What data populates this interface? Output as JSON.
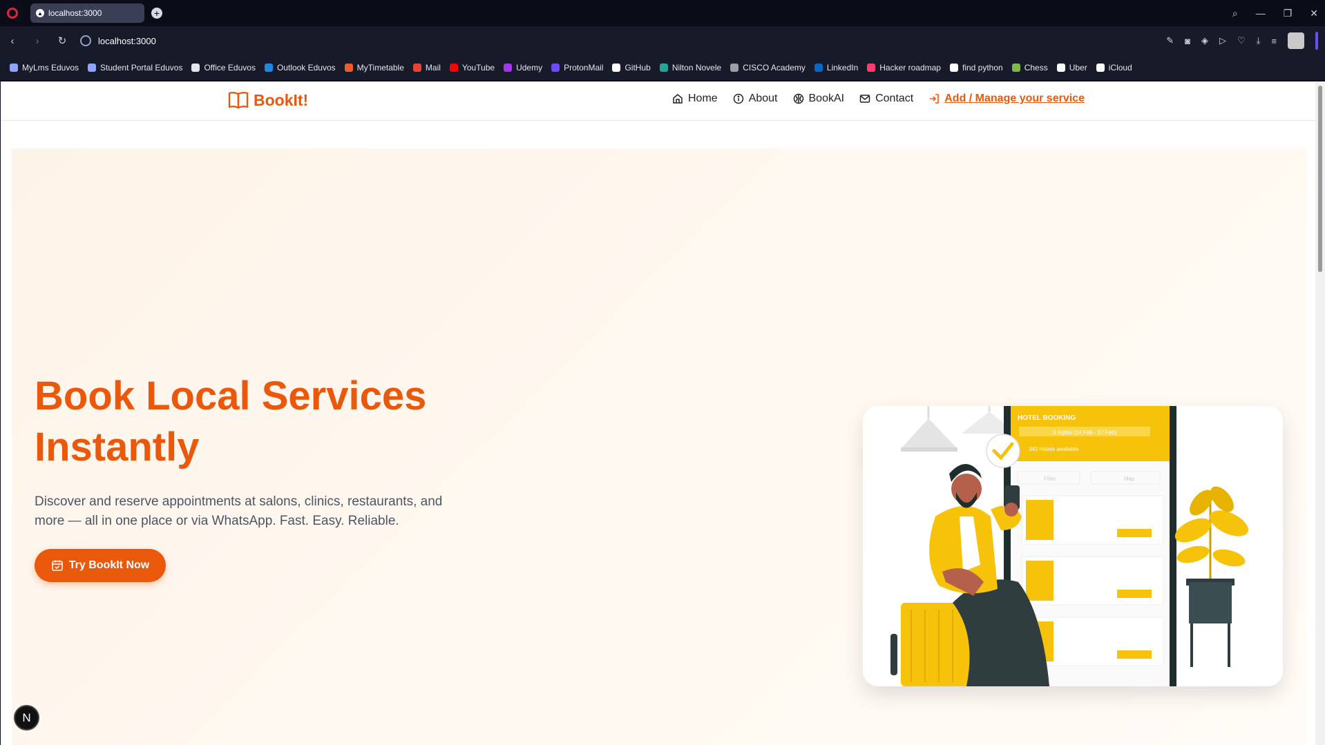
{
  "browser": {
    "tab_title": "localhost:3000",
    "url": "localhost:3000",
    "bookmarks": [
      {
        "label": "MyLms Eduvos",
        "color": "#8ea2ff"
      },
      {
        "label": "Student Portal Eduvos",
        "color": "#8ea2ff"
      },
      {
        "label": "Office Eduvos",
        "color": "#e6e7ee"
      },
      {
        "label": "Outlook Eduvos",
        "color": "#1e88e5"
      },
      {
        "label": "MyTimetable",
        "color": "#ef5b2b"
      },
      {
        "label": "Mail",
        "color": "#ea4335"
      },
      {
        "label": "YouTube",
        "color": "#ff0000"
      },
      {
        "label": "Udemy",
        "color": "#a435f0"
      },
      {
        "label": "ProtonMail",
        "color": "#6d4aff"
      },
      {
        "label": "GitHub",
        "color": "#ffffff"
      },
      {
        "label": "Nilton Novele",
        "color": "#26a69a"
      },
      {
        "label": "CISCO Academy",
        "color": "#9aa0a6"
      },
      {
        "label": "LinkedIn",
        "color": "#0a66c2"
      },
      {
        "label": "Hacker roadmap",
        "color": "#ff3d71"
      },
      {
        "label": "find python",
        "color": "#ffffff"
      },
      {
        "label": "Chess",
        "color": "#81b64c"
      },
      {
        "label": "Uber",
        "color": "#ffffff"
      },
      {
        "label": "iCloud",
        "color": "#ffffff"
      }
    ]
  },
  "site": {
    "brand": "BookIt!",
    "accent_color": "#ea580c",
    "nav": {
      "home": "Home",
      "about": "About",
      "bookai": "BookAI",
      "contact": "Contact",
      "cta": "Add / Manage your service"
    },
    "hero": {
      "title": "Book Local Services Instantly",
      "description": "Discover and reserve appointments at salons, clinics, restaurants, and more — all in one place or via WhatsApp. Fast. Easy. Reliable.",
      "button": "Try BookIt Now"
    },
    "illustration": {
      "header": "HOTEL BOOKING",
      "dates": "3 nights (14 Feb - 17 Feb)",
      "available": "343 Hotels available",
      "filter": "Filter",
      "map": "Map"
    }
  },
  "badge": "N"
}
